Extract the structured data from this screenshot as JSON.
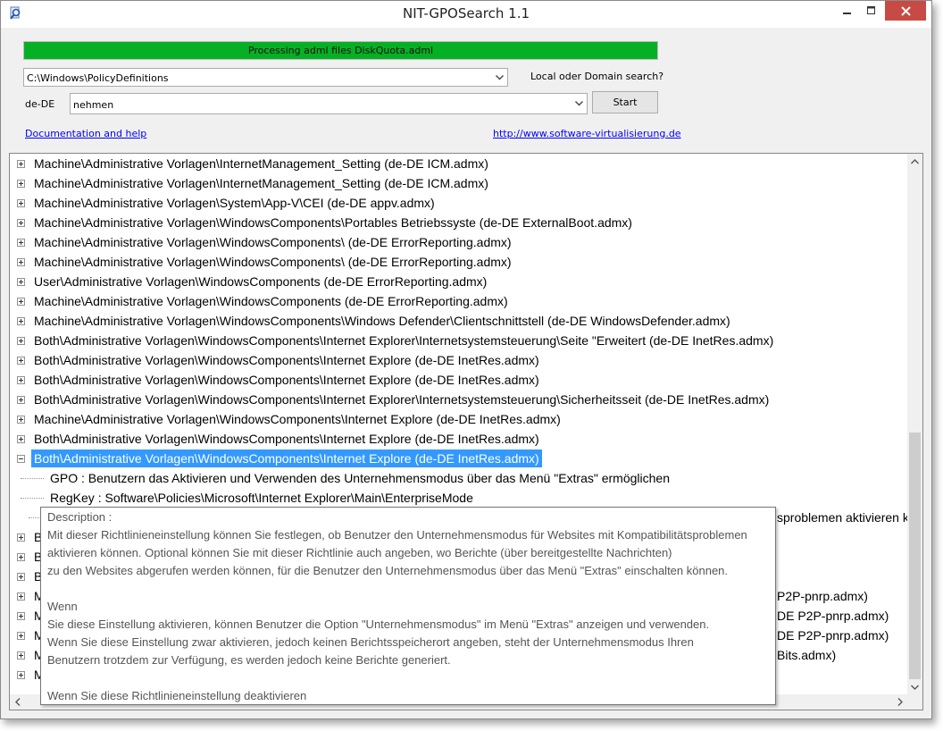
{
  "window": {
    "title": "NIT-GPOSearch 1.1"
  },
  "progress": {
    "text": "Processing adml files DiskQuota.adml",
    "fraction": 1.0,
    "color": "#06b025"
  },
  "path_combo": {
    "value": "C:\\Windows\\PolicyDefinitions"
  },
  "search_type_label": "Local oder Domain search?",
  "language_label": "de-DE",
  "search_combo": {
    "value": "nehmen"
  },
  "start_label": "Start",
  "links": {
    "documentation": "Documentation and help",
    "website": "http://www.software-virtualisierung.de"
  },
  "tree": {
    "items": [
      {
        "text": "Machine\\Administrative Vorlagen\\InternetManagement_Setting   (de-DE ICM.admx)"
      },
      {
        "text": "Machine\\Administrative Vorlagen\\InternetManagement_Setting   (de-DE ICM.admx)"
      },
      {
        "text": "Machine\\Administrative Vorlagen\\System\\App-V\\CEI   (de-DE appv.admx)"
      },
      {
        "text": "Machine\\Administrative Vorlagen\\WindowsComponents\\Portables Betriebssyste   (de-DE ExternalBoot.admx)"
      },
      {
        "text": "Machine\\Administrative Vorlagen\\WindowsComponents\\   (de-DE ErrorReporting.admx)"
      },
      {
        "text": "Machine\\Administrative Vorlagen\\WindowsComponents\\   (de-DE ErrorReporting.admx)"
      },
      {
        "text": "User\\Administrative Vorlagen\\WindowsComponents   (de-DE ErrorReporting.admx)"
      },
      {
        "text": "Machine\\Administrative Vorlagen\\WindowsComponents   (de-DE ErrorReporting.admx)"
      },
      {
        "text": "Machine\\Administrative Vorlagen\\WindowsComponents\\Windows Defender\\Clientschnittstell   (de-DE WindowsDefender.admx)"
      },
      {
        "text": "Both\\Administrative Vorlagen\\WindowsComponents\\Internet Explorer\\Internetsystemsteuerung\\Seite \"Erweitert   (de-DE InetRes.admx)"
      },
      {
        "text": "Both\\Administrative Vorlagen\\WindowsComponents\\Internet Explore   (de-DE InetRes.admx)"
      },
      {
        "text": "Both\\Administrative Vorlagen\\WindowsComponents\\Internet Explore   (de-DE InetRes.admx)"
      },
      {
        "text": "Both\\Administrative Vorlagen\\WindowsComponents\\Internet Explorer\\Internetsystemsteuerung\\Sicherheitsseit   (de-DE InetRes.admx)"
      },
      {
        "text": "Machine\\Administrative Vorlagen\\WindowsComponents\\Internet Explore   (de-DE InetRes.admx)"
      },
      {
        "text": "Both\\Administrative Vorlagen\\WindowsComponents\\Internet Explore   (de-DE InetRes.admx)"
      },
      {
        "text": "Both\\Administrative Vorlagen\\WindowsComponents\\Internet Explore   (de-DE InetRes.admx)"
      }
    ],
    "children": [
      {
        "text": "GPO : Benutzern das Aktivieren und Verwenden des Unternehmensmodus über das Menü \"Extras\" ermöglichen"
      },
      {
        "text": "RegKey : Software\\Policies\\Microsoft\\Internet Explorer\\Main\\EnterpriseMode"
      }
    ],
    "partial": {
      "child3_tail": "sproblemen aktivieren kö",
      "left_stubs": [
        "Bo",
        "Bo",
        "Bo",
        "M",
        "M",
        "M",
        "M",
        "M"
      ],
      "right_tails": [
        "P2P-pnrp.admx)",
        "DE P2P-pnrp.admx)",
        "DE P2P-pnrp.admx)",
        "Bits.admx)"
      ]
    }
  },
  "tooltip": {
    "lines": [
      "Description :",
      "Mit dieser Richtlinieneinstellung können Sie festlegen, ob Benutzer den Unternehmensmodus für Websites mit Kompatibilitätsproblemen",
      "  aktivieren können. Optional können Sie mit dieser Richtlinie auch angeben, wo Berichte (über bereitgestellte Nachrichten)",
      "  zu den Websites abgerufen werden können, für die Benutzer den Unternehmensmodus über das Menü \"Extras\" einschalten können.",
      "",
      "Wenn",
      "  Sie diese Einstellung aktivieren, können Benutzer die Option \"Unternehmensmodus\" im Menü \"Extras\" anzeigen und verwenden.",
      "  Wenn Sie diese Einstellung zwar aktivieren, jedoch keinen Berichtsspeicherort angeben, steht der Unternehmensmodus Ihren",
      "  Benutzern trotzdem zur Verfügung, es werden jedoch keine Berichte generiert.",
      "",
      "Wenn Sie diese Richtlinieneinstellung deaktivieren"
    ]
  }
}
